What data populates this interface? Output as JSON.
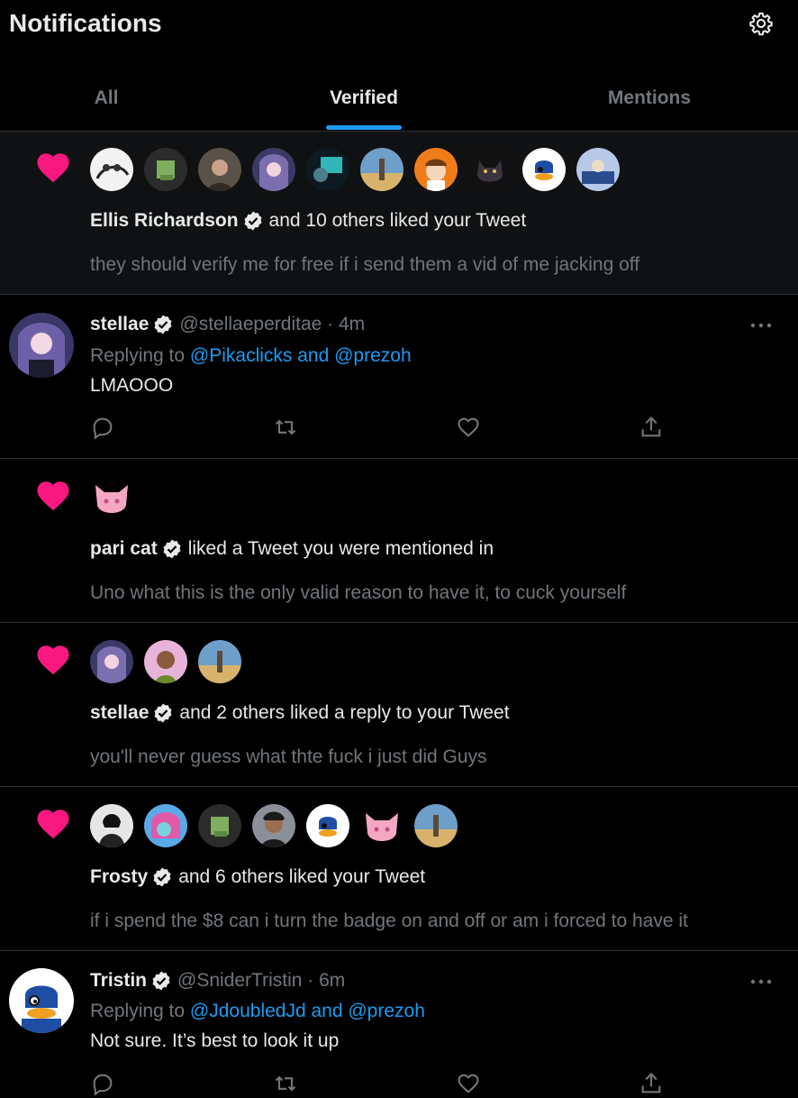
{
  "header": {
    "title": "Notifications",
    "settings_icon": "gear-icon"
  },
  "tabs": [
    {
      "label": "All",
      "active": false
    },
    {
      "label": "Verified",
      "active": true
    },
    {
      "label": "Mentions",
      "active": false
    }
  ],
  "colors": {
    "accent": "#1d9bf0",
    "heart": "#f91880",
    "muted": "#71767b",
    "text": "#e7e9ea",
    "background": "#000000"
  },
  "notifications": [
    {
      "type": "like",
      "icon": "heart-icon",
      "actor": "Ellis Richardson",
      "verified": true,
      "action": "and 10 others liked your Tweet",
      "snippet": "they should verify me for free if i send them a vid of me jacking off"
    },
    {
      "type": "tweet",
      "name": "stellae",
      "verified": true,
      "meta": "@stellaeperditae · 4m",
      "replying_prefix": "Replying to",
      "replying_mentions": "@Pikaclicks and @prezoh",
      "text": "LMAOOO"
    },
    {
      "type": "like",
      "icon": "heart-icon",
      "actor": "pari cat",
      "verified": true,
      "action": "liked a Tweet you were mentioned in",
      "snippet": "Uno what this is the only valid reason to have it, to cuck yourself"
    },
    {
      "type": "like",
      "icon": "heart-icon",
      "actor": "stellae",
      "verified": true,
      "action": "and 2 others liked a reply to your Tweet",
      "snippet": "you'll never guess what thte fuck i just did Guys"
    },
    {
      "type": "like",
      "icon": "heart-icon",
      "actor": "Frosty",
      "verified": true,
      "action": "and 6 others liked your Tweet",
      "snippet": "if i spend the $8 can i turn the badge on and off or am i forced to have it"
    },
    {
      "type": "tweet",
      "name": "Tristin",
      "verified": true,
      "meta": "@SniderTristin · 6m",
      "replying_prefix": "Replying to",
      "replying_mentions": "@JdoubledJd and @prezoh",
      "text": "Not sure. It’s best to look it up"
    }
  ]
}
